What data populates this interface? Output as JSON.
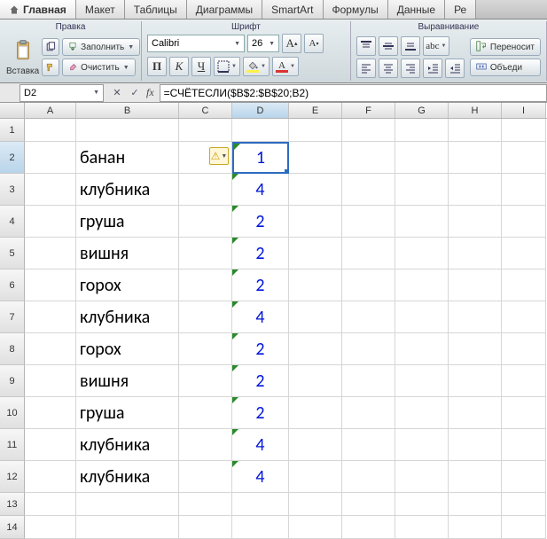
{
  "ribbon": {
    "tabs": [
      "Главная",
      "Макет",
      "Таблицы",
      "Диаграммы",
      "SmartArt",
      "Формулы",
      "Данные",
      "Ре"
    ],
    "groups": {
      "edit": "Правка",
      "font": "Шрифт",
      "align": "Выравнивание"
    },
    "paste_label": "Вставка",
    "fill_label": "Заполнить",
    "clear_label": "Очистить",
    "font_name": "Calibri",
    "font_size": "26",
    "wrap_label": "Переносит",
    "merge_label": "Объеди"
  },
  "namebox": "D2",
  "formula": "=СЧЁТЕСЛИ($B$2:$B$20;B2)",
  "columns": [
    "A",
    "B",
    "C",
    "D",
    "E",
    "F",
    "G",
    "H",
    "I"
  ],
  "rows": [
    {
      "n": 1
    },
    {
      "n": 2,
      "b": "банан",
      "d": "1",
      "selected": true,
      "warn": true
    },
    {
      "n": 3,
      "b": "клубника",
      "d": "4"
    },
    {
      "n": 4,
      "b": "груша",
      "d": "2"
    },
    {
      "n": 5,
      "b": "вишня",
      "d": "2"
    },
    {
      "n": 6,
      "b": "горох",
      "d": "2"
    },
    {
      "n": 7,
      "b": "клубника",
      "d": "4"
    },
    {
      "n": 8,
      "b": "горох",
      "d": "2"
    },
    {
      "n": 9,
      "b": "вишня",
      "d": "2"
    },
    {
      "n": 10,
      "b": "груша",
      "d": "2"
    },
    {
      "n": 11,
      "b": "клубника",
      "d": "4"
    },
    {
      "n": 12,
      "b": "клубника",
      "d": "4"
    },
    {
      "n": 13
    },
    {
      "n": 14
    }
  ],
  "chart_data": {
    "type": "table",
    "title": "COUNTIF values for column B",
    "series": [
      {
        "name": "банан",
        "values": [
          1
        ]
      },
      {
        "name": "клубника",
        "values": [
          4
        ]
      },
      {
        "name": "груша",
        "values": [
          2
        ]
      },
      {
        "name": "вишня",
        "values": [
          2
        ]
      },
      {
        "name": "горох",
        "values": [
          2
        ]
      },
      {
        "name": "клубника",
        "values": [
          4
        ]
      },
      {
        "name": "горох",
        "values": [
          2
        ]
      },
      {
        "name": "вишня",
        "values": [
          2
        ]
      },
      {
        "name": "груша",
        "values": [
          2
        ]
      },
      {
        "name": "клубника",
        "values": [
          4
        ]
      },
      {
        "name": "клубника",
        "values": [
          4
        ]
      }
    ]
  }
}
